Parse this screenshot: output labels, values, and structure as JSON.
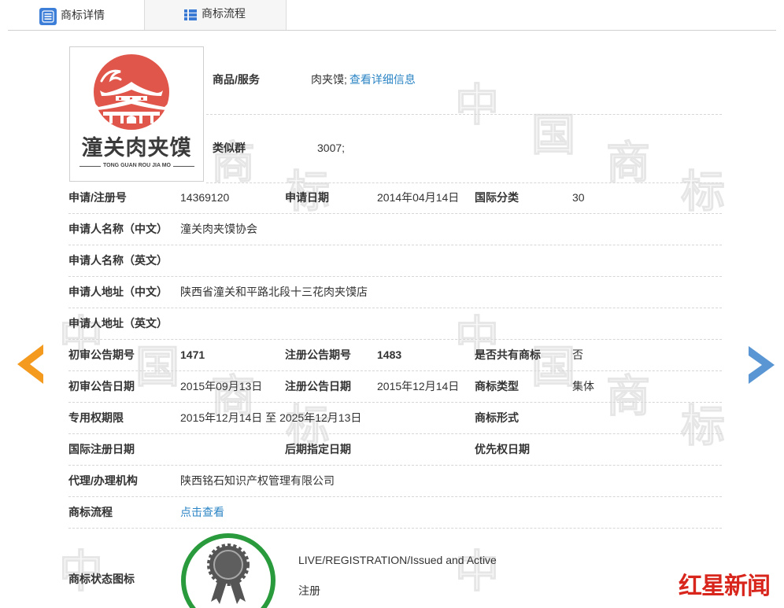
{
  "tabs": [
    {
      "label": "商标详情",
      "icon": "document-icon",
      "active": true
    },
    {
      "label": "商标流程",
      "icon": "list-icon",
      "active": false
    }
  ],
  "trademark_image": {
    "name_cn": "潼关肉夹馍",
    "name_pinyin": "TONG GUAN ROU JIA MO",
    "seal_color": "#e0564a"
  },
  "goods_services": {
    "label": "商品/服务",
    "value": "肉夹馍;",
    "link": "查看详细信息"
  },
  "similar_group": {
    "label": "类似群",
    "value": "3007;"
  },
  "rows": [
    [
      {
        "label": "申请/注册号",
        "value": "14369120"
      },
      {
        "label": "申请日期",
        "value": "2014年04月14日"
      },
      {
        "label": "国际分类",
        "value": "30"
      }
    ],
    [
      {
        "label": "申请人名称（中文）",
        "value": "潼关肉夹馍协会"
      }
    ],
    [
      {
        "label": "申请人名称（英文）"
      }
    ],
    [
      {
        "label": "申请人地址（中文）",
        "value": "陕西省潼关和平路北段十三花肉夹馍店"
      }
    ],
    [
      {
        "label": "申请人地址（英文）"
      }
    ],
    [
      {
        "label": "初审公告期号",
        "value": "1471"
      },
      {
        "label": "注册公告期号",
        "value": "1483"
      },
      {
        "label": "是否共有商标",
        "value": "否"
      }
    ],
    [
      {
        "label": "初审公告日期",
        "value": "2015年09月13日"
      },
      {
        "label": "注册公告日期",
        "value": "2015年12月14日"
      },
      {
        "label": "商标类型",
        "value": "集体"
      }
    ],
    [
      {
        "label": "专用权期限",
        "value": "2015年12月14日 至 2025年12月13日"
      },
      {
        "label": "商标形式"
      }
    ],
    [
      {
        "label": "国际注册日期"
      },
      {
        "label": "后期指定日期"
      },
      {
        "label": "优先权日期"
      }
    ],
    [
      {
        "label": "代理/办理机构",
        "value": "陕西铭石知识产权管理有限公司"
      }
    ],
    [
      {
        "label": "商标流程",
        "link": "点击查看"
      }
    ]
  ],
  "status": {
    "label": "商标状态图标",
    "icon": "registered-seal-icon",
    "ring_color": "#2a9b3c",
    "text_en": "LIVE/REGISTRATION/Issued and Active",
    "text_cn": "注册"
  },
  "navigation": {
    "prev_icon": "chevron-left-icon",
    "prev_color": "#f39a1f",
    "next_icon": "chevron-right-icon",
    "next_color": "#5a96d4"
  },
  "watermark": {
    "chars": [
      "中",
      "国",
      "商",
      "标"
    ]
  },
  "source_logo": {
    "text": "红星新闻",
    "color": "#d8261d"
  },
  "colors": {
    "link": "#2c85c5",
    "text": "#333333",
    "tab_icon": "#3c7ed8"
  }
}
